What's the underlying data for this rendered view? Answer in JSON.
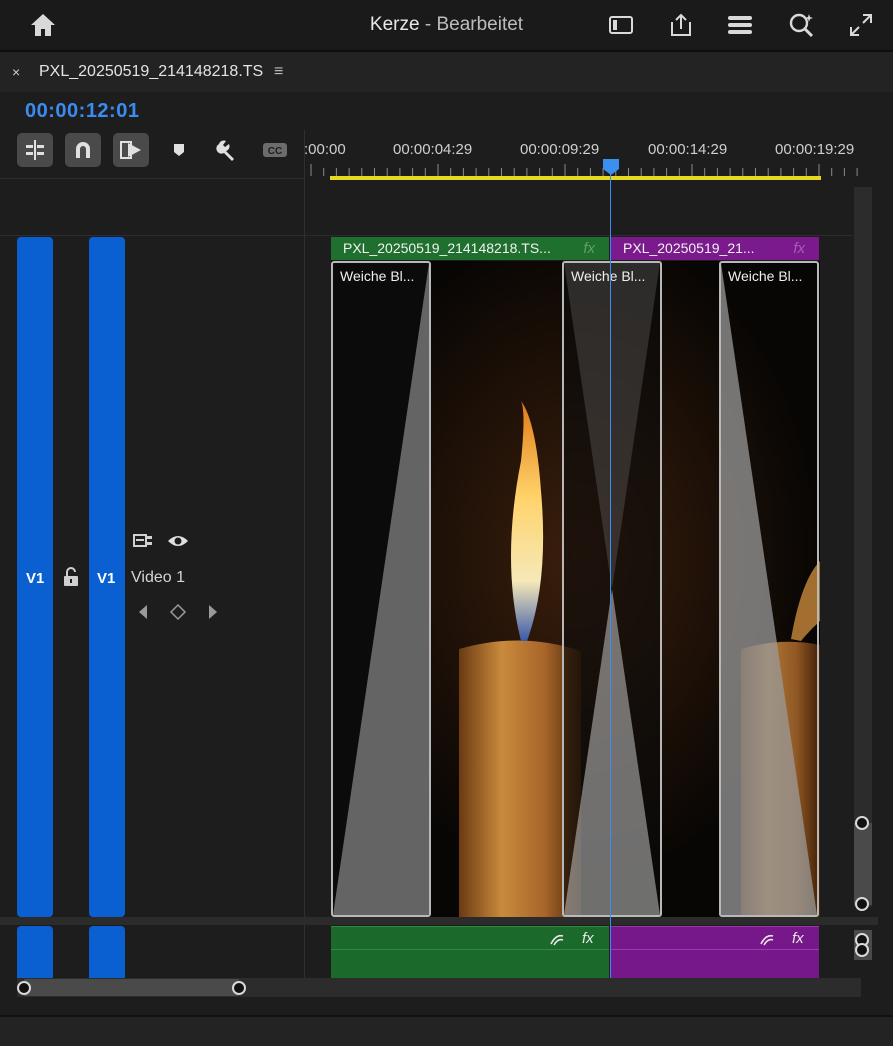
{
  "app": {
    "title": "Kerze",
    "title_sep": " - ",
    "subtitle": "Bearbeitet"
  },
  "panel": {
    "close_glyph": "×",
    "sequence_name": "PXL_20250519_214148218.TS",
    "menu_glyph": "≡",
    "timecode": "00:00:12:01"
  },
  "ruler": {
    "labels": [
      ":00:00",
      "00:00:04:29",
      "00:00:09:29",
      "00:00:14:29",
      "00:00:19:29"
    ]
  },
  "tracks": {
    "video": {
      "source_patch": "V1",
      "target": "V1",
      "name": "Video 1"
    }
  },
  "clips": [
    {
      "name": "PXL_20250519_214148218.TS...",
      "fx": "fx",
      "color": "#1f6f2e"
    },
    {
      "name": "PXL_20250519_21...",
      "fx": "fx",
      "color": "#7a1a8c"
    }
  ],
  "transitions": [
    {
      "label": "Weiche Bl..."
    },
    {
      "label": "Weiche Bl..."
    },
    {
      "label": "Weiche Bl..."
    }
  ],
  "audio_fx": {
    "fx1": "fx",
    "fx2": "fx"
  },
  "colors": {
    "accent": "#3b8cf2",
    "track_blue": "#0a5fd1",
    "work_area": "#e6d91f",
    "clip_green": "#1f6f2e",
    "clip_purple": "#7a1a8c",
    "playhead": "#3a8ff0"
  },
  "icons": {
    "home": "home-icon",
    "panel": "panel-icon",
    "share": "share-icon",
    "sliders": "sliders-icon",
    "search": "search-icon",
    "fullscreen": "fullscreen-icon"
  }
}
